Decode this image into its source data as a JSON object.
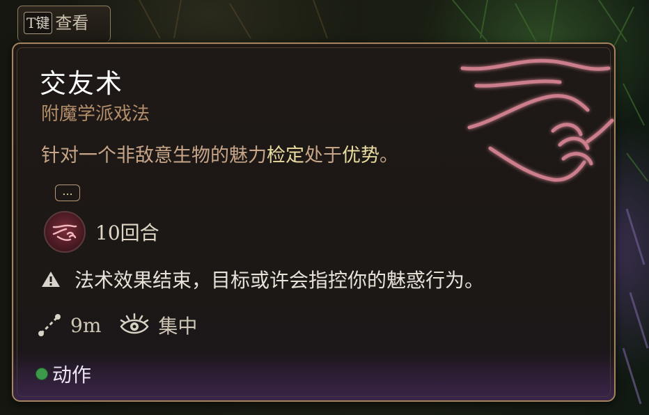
{
  "key_hint": {
    "key": "T键",
    "label": "查看"
  },
  "spell": {
    "name": "交友术",
    "school": "附魔学派戏法",
    "description_before": "针对一个非敌意生物的魅力",
    "description_highlight1": "检定",
    "description_mid": "处于",
    "description_highlight2": "优势",
    "description_after": "。",
    "more_label": "...",
    "duration": "10回合",
    "warning": "法术效果结束，目标或许会指控你的魅惑行为。",
    "range": "9m",
    "concentration": "集中",
    "action_type": "动作"
  },
  "colors": {
    "border": "#a5835e",
    "school": "#b38e6a",
    "highlight": "#e8dca0",
    "action_dot": "#3d9a4b"
  },
  "icons": {
    "spell_art": "handshake-icon",
    "duration": "handshake-icon",
    "warning": "warning-icon",
    "range": "range-icon",
    "concentration": "concentration-eye-icon"
  }
}
